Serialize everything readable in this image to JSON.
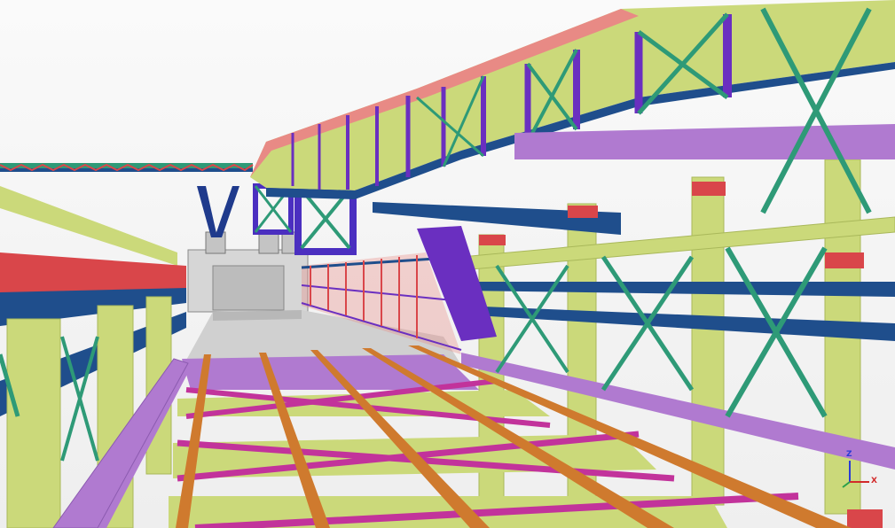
{
  "viewport": {
    "title": "",
    "background": "#f3f3f3"
  },
  "model": {
    "description_kind": "3d-structural-model",
    "member_colors": {
      "column_lime": "#cbd97a",
      "column_lime_dark": "#a9b85a",
      "bracing_teal": "#2e9a77",
      "beam_navy": "#1f4e8c",
      "beam_purple": "#6a2fc0",
      "girder_violet": "#b07ad0",
      "bracket_red": "#d9464a",
      "bracket_salmon": "#e88a85",
      "rail_orange": "#cf7a2e",
      "tie_magenta": "#c2339b",
      "concrete_grey": "#c9c9c9"
    }
  },
  "axis_indicator": {
    "z_label": "Z",
    "x_label": "X",
    "z_color": "#2a3bd6",
    "x_color": "#d22a2a",
    "y_color": "#2aa04a"
  }
}
